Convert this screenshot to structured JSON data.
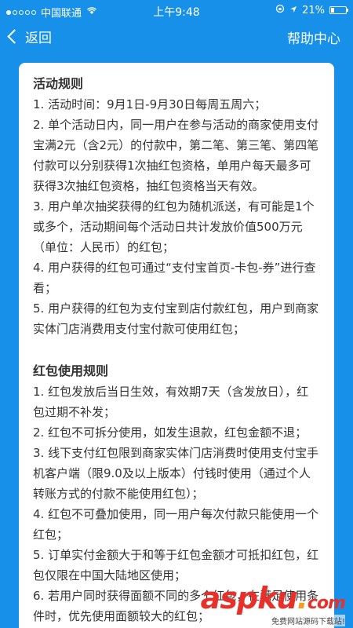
{
  "status_bar": {
    "carrier": "中国联通",
    "time": "上午9:48",
    "battery": "21%",
    "battery_level": 0.21
  },
  "nav": {
    "back_label": "返回",
    "help_label": "帮助中心"
  },
  "sections": [
    {
      "title": "活动规则",
      "items": [
        "1. 活动时间：9月1日-9月30日每周五周六；",
        "2. 单个活动日内，同一用户在参与活动的商家使用支付宝满2元（含2元）的付款中，第二笔、第三笔、第四笔付款可以分别获得1次抽红包资格，单用户每天最多可获得3次抽红包资格，抽红包资格当天有效。",
        "3. 用户单次抽奖获得的红包为随机派送，有可能是1个或多个，活动期间每个活动日共计发放价值500万元（单位：人民币）的红包；",
        "4. 用户获得的红包可通过“支付宝首页-卡包-券”进行查看；",
        "5. 用户获得的红包为支付宝到店付款红包，用户到商家实体门店消费用支付宝付款可使用红包；"
      ]
    },
    {
      "title": "红包使用规则",
      "items": [
        "1. 红包发放后当日生效，有效期7天（含发放日），红包过期不补发；",
        "2. 红包不可拆分使用，如发生退款，红包金额不退；",
        "3. 线下支付红包限到商家实体门店消费时使用支付宝手机客户端（限9.0及以上版本）付钱时使用（通过个人转账方式的付款不能使用红包）；",
        "4. 红包不可叠加使用，同一用户每次付款只能使用一个红包；",
        "5. 订单实付金额大于和等于红包金额才可抵扣红包，红包仅限在中国大陆地区使用；",
        "6. 若用户同时获得面额不同的多个红包，在满足使用条件时，优先使用面额较大的红包；"
      ]
    }
  ],
  "watermark": {
    "asp": "asp",
    "ku": "ku",
    "dot": ".",
    "com": "com",
    "sub": "免费网站源码下载站!"
  }
}
